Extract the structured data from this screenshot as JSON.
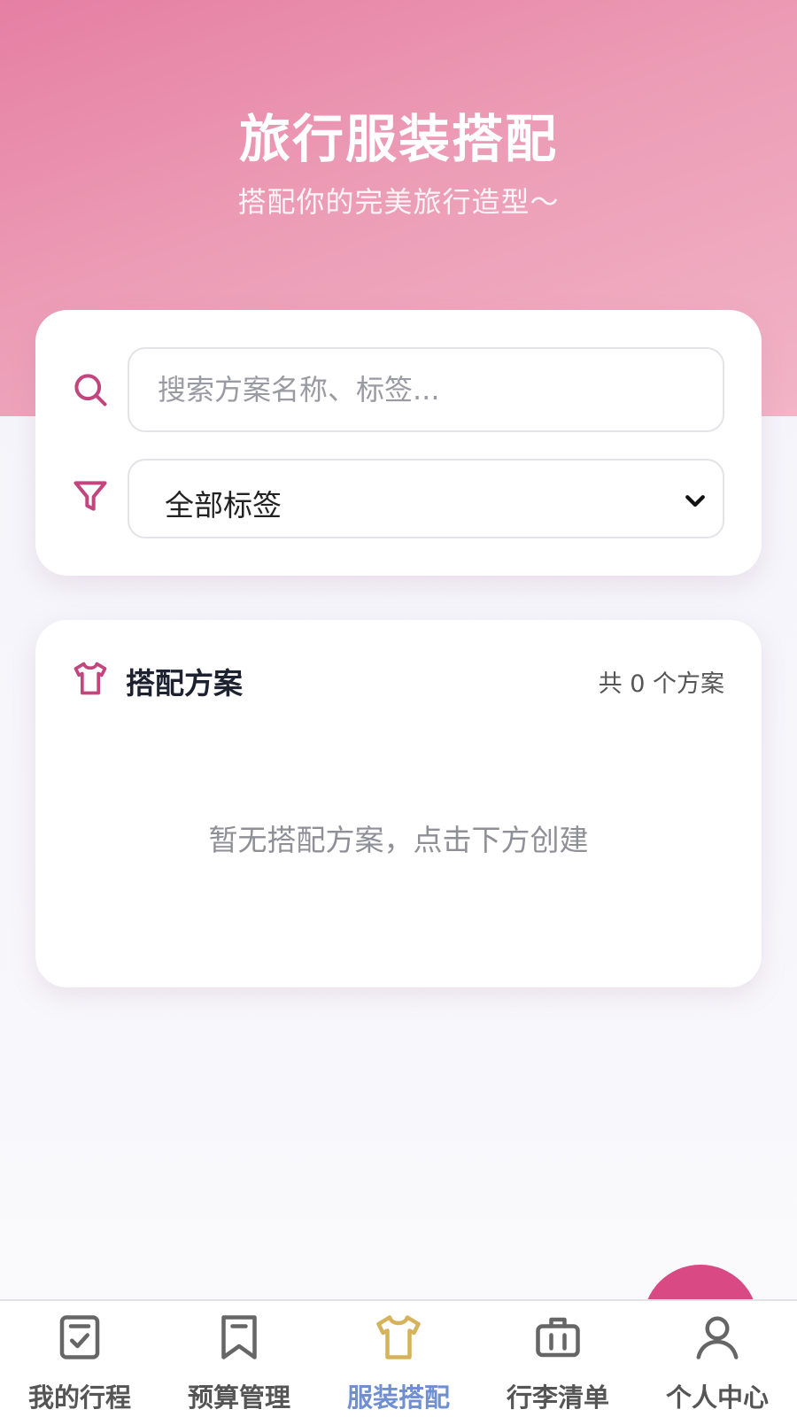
{
  "header": {
    "title": "旅行服装搭配",
    "subtitle": "搭配你的完美旅行造型～"
  },
  "filters": {
    "search_placeholder": "搜索方案名称、标签...",
    "search_value": "",
    "tag_select_value": "全部标签"
  },
  "outfits": {
    "title": "搭配方案",
    "count_text": "共 0 个方案",
    "empty_text": "暂无搭配方案，点击下方创建"
  },
  "tabbar": {
    "items": [
      {
        "label": "我的行程",
        "icon": "itinerary-check-icon",
        "active": false
      },
      {
        "label": "预算管理",
        "icon": "bookmark-icon",
        "active": false
      },
      {
        "label": "服装搭配",
        "icon": "tshirt-icon",
        "active": true
      },
      {
        "label": "行李清单",
        "icon": "suitcase-icon",
        "active": false
      },
      {
        "label": "个人中心",
        "icon": "user-icon",
        "active": false
      }
    ]
  },
  "colors": {
    "accent": "#d94a85",
    "icon_pink": "#c2457e",
    "tab_active": "#6f8fd0",
    "tab_active_icon": "#d6b35a"
  }
}
